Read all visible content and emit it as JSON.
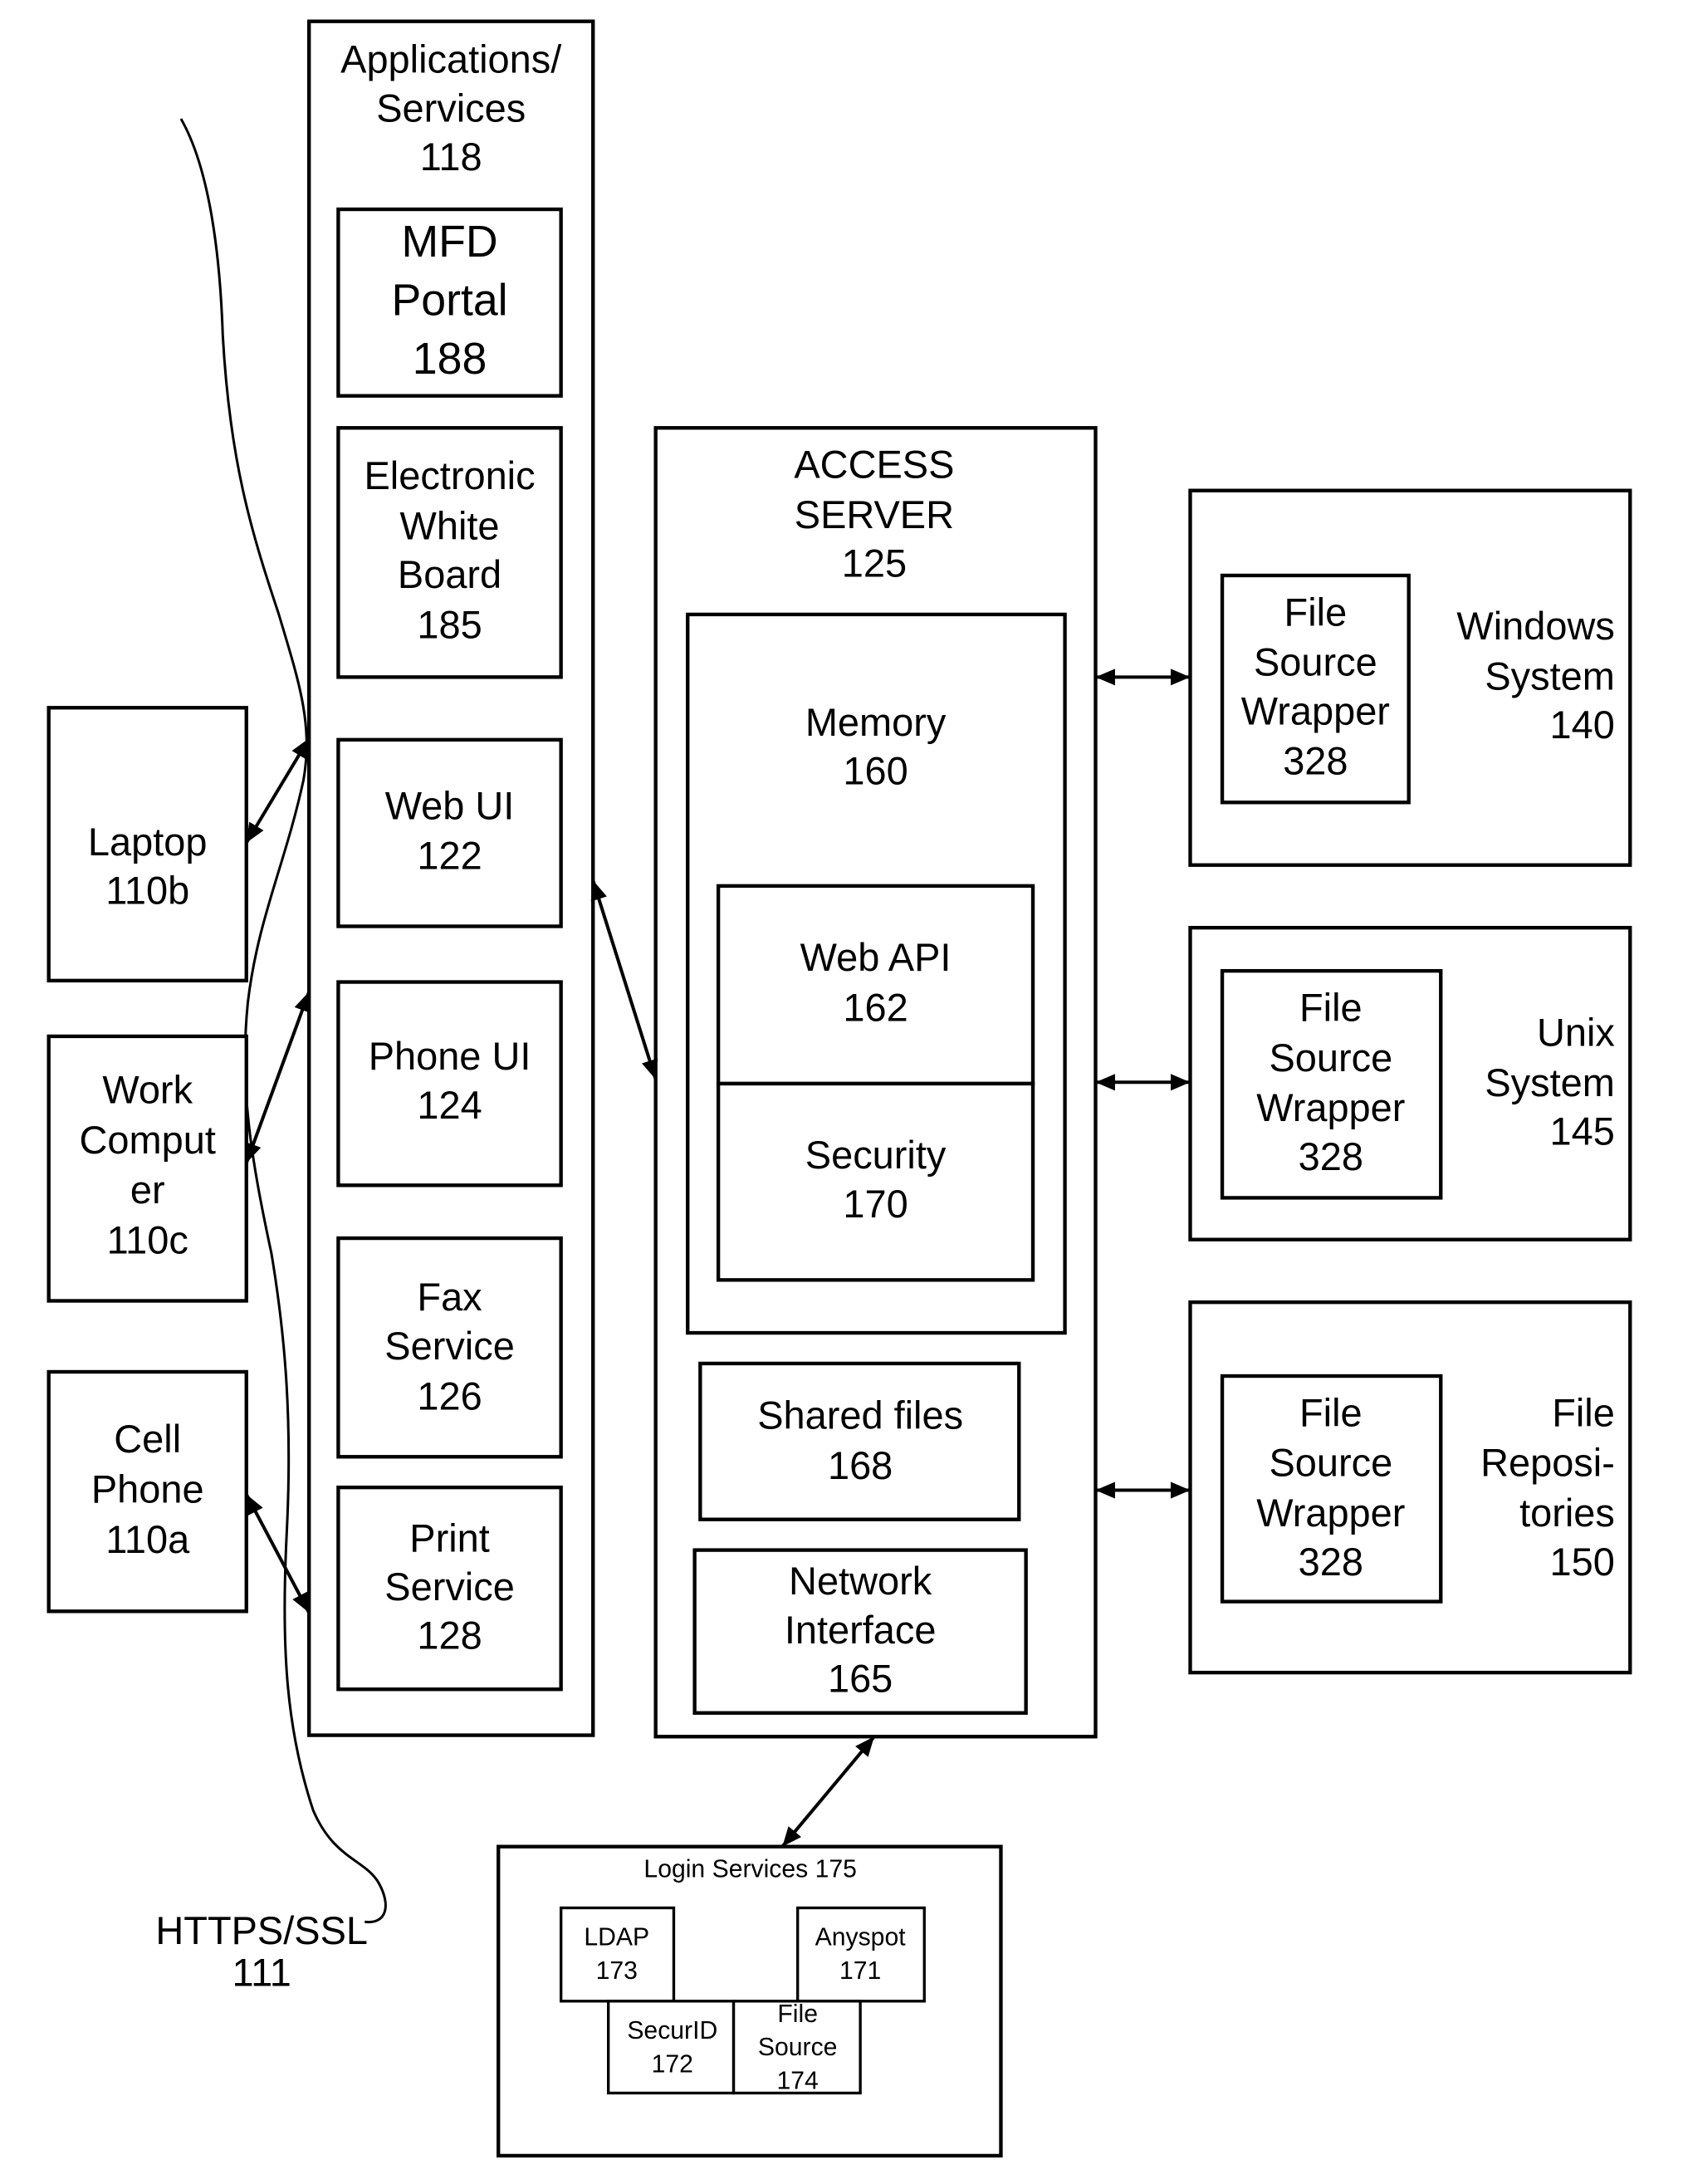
{
  "diagram": {
    "network_label": {
      "name": "HTTPS/SSL",
      "ref": "111"
    },
    "clients": [
      {
        "id": "laptop",
        "lines": [
          "Laptop",
          "110b"
        ]
      },
      {
        "id": "work-computer",
        "lines": [
          "Work",
          "Comput",
          "er",
          "110c"
        ]
      },
      {
        "id": "cell-phone",
        "lines": [
          "Cell",
          "Phone",
          "110a"
        ]
      }
    ],
    "applications": {
      "title": [
        "Applications/",
        "Services",
        "118"
      ],
      "items": [
        {
          "id": "mfd-portal",
          "lines": [
            "MFD",
            "Portal",
            "188"
          ]
        },
        {
          "id": "electronic-white-board",
          "lines": [
            "Electronic",
            "White",
            "Board",
            "185"
          ]
        },
        {
          "id": "web-ui",
          "lines": [
            "Web UI",
            "122"
          ]
        },
        {
          "id": "phone-ui",
          "lines": [
            "Phone UI",
            "124"
          ]
        },
        {
          "id": "fax-service",
          "lines": [
            "Fax",
            "Service",
            "126"
          ]
        },
        {
          "id": "print-service",
          "lines": [
            "Print",
            "Service",
            "128"
          ]
        }
      ]
    },
    "access_server": {
      "title": [
        "ACCESS",
        "SERVER",
        "125"
      ],
      "memory": {
        "lines": [
          "Memory",
          "160"
        ]
      },
      "web_api": {
        "lines": [
          "Web API",
          "162"
        ]
      },
      "security": {
        "lines": [
          "Security",
          "170"
        ]
      },
      "shared_files": {
        "lines": [
          "Shared files",
          "168"
        ]
      },
      "network_interface": {
        "lines": [
          "Network",
          "Interface",
          "165"
        ]
      }
    },
    "systems": [
      {
        "id": "windows-system",
        "lines": [
          "Windows",
          "System",
          "140"
        ],
        "wrapper": [
          "File",
          "Source",
          "Wrapper",
          "328"
        ]
      },
      {
        "id": "unix-system",
        "lines": [
          "Unix",
          "System",
          "145"
        ],
        "wrapper": [
          "File",
          "Source",
          "Wrapper",
          "328"
        ]
      },
      {
        "id": "file-repositories",
        "lines": [
          "File",
          "Reposi-",
          "tories",
          "150"
        ],
        "wrapper": [
          "File",
          "Source",
          "Wrapper",
          "328"
        ]
      }
    ],
    "login_services": {
      "title": "Login Services 175",
      "items": [
        {
          "id": "ldap",
          "lines": [
            "LDAP",
            "173"
          ]
        },
        {
          "id": "anyspot",
          "lines": [
            "Anyspot",
            "171"
          ]
        },
        {
          "id": "securid",
          "lines": [
            "SecurID",
            "172"
          ]
        },
        {
          "id": "file-source",
          "lines": [
            "File",
            "Source",
            "174"
          ]
        }
      ]
    }
  }
}
